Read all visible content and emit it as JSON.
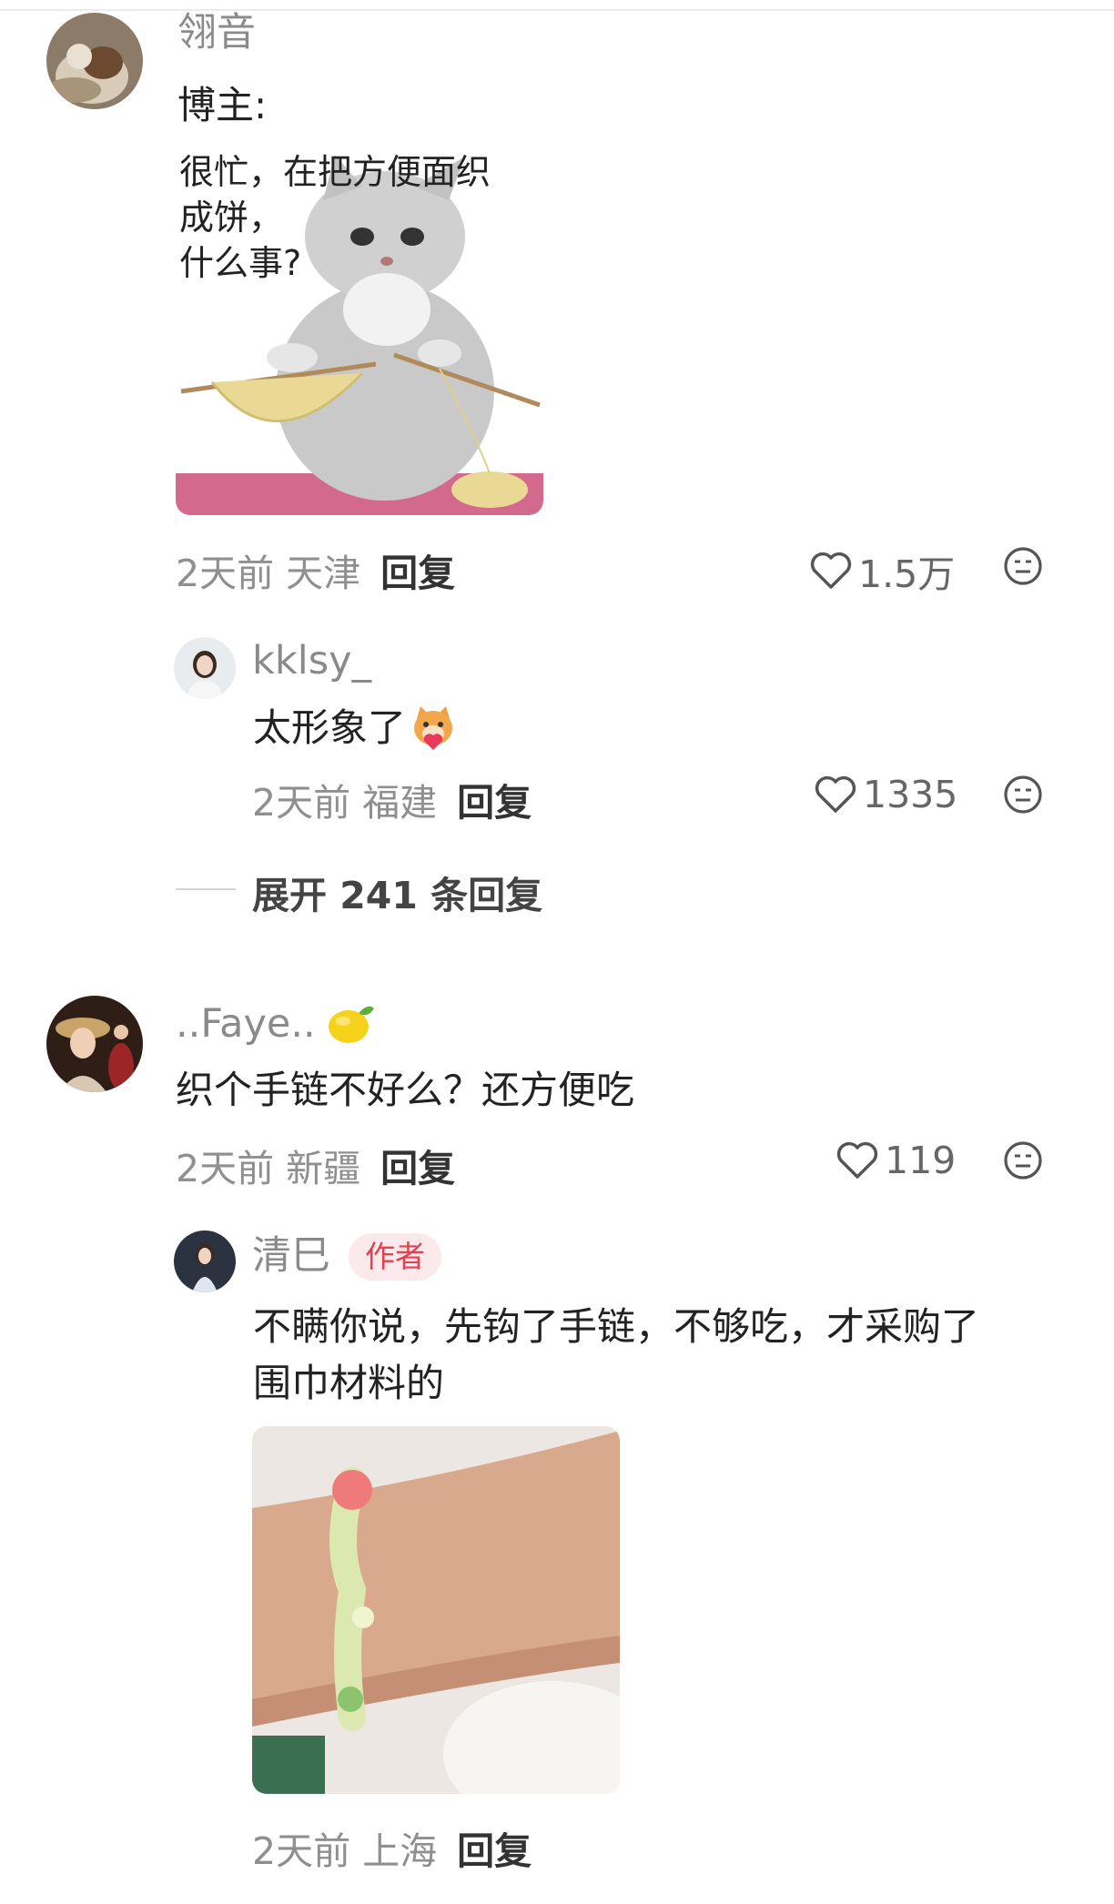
{
  "comments": [
    {
      "username": "翎音",
      "text_line1": "博主:",
      "sticker_text": [
        "很忙，在把方便面织",
        "成饼，",
        "什么事?"
      ],
      "meta": "2天前 天津",
      "reply_label": "回复",
      "likes": "1.5万",
      "replies": [
        {
          "username": "kklsy_",
          "text": "太形象了",
          "meta": "2天前 福建",
          "reply_label": "回复",
          "likes": "1335"
        }
      ],
      "expand_label": "展开 241 条回复"
    },
    {
      "username": "..Faye..",
      "text": "织个手链不好么？还方便吃",
      "meta": "2天前 新疆",
      "reply_label": "回复",
      "likes": "119",
      "replies": [
        {
          "username": "清巳",
          "badge": "作者",
          "text_line1": "不瞒你说，先钩了手链，不够吃，才采购了",
          "text_line2": "围巾材料的",
          "meta": "2天前 上海",
          "reply_label": "回复"
        }
      ]
    }
  ],
  "colors": {
    "badge_bg": "#fbe9ec",
    "badge_text": "#e4404f",
    "meta": "#8f8f8f"
  },
  "icons": [
    "heart-outline-icon",
    "face-neutral-icon",
    "lemon-emoji",
    "cat-heart-emoji"
  ]
}
